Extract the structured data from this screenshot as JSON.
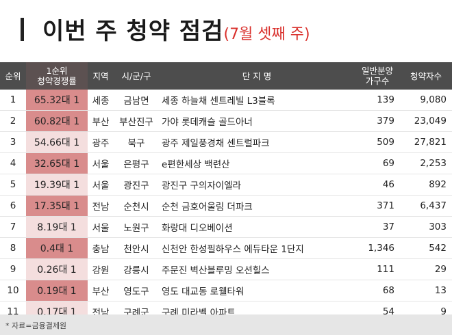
{
  "header": {
    "title": "이번 주 청약 점검",
    "subtitle": "(7월 셋째 주)"
  },
  "table": {
    "columns": {
      "rank": "순위",
      "rate_line1": "1순위",
      "rate_line2": "청약경쟁률",
      "region": "지역",
      "city": "시/군/구",
      "complex": "단 지 명",
      "units_line1": "일반분양",
      "units_line2": "가구수",
      "applicants": "청약자수"
    },
    "rows": [
      {
        "rank": "1",
        "rate": "65.32대 1",
        "region": "세종",
        "city": "금남면",
        "complex": "세종 하늘채 센트레빌 L3블록",
        "units": "139",
        "applicants": "9,080"
      },
      {
        "rank": "2",
        "rate": "60.82대 1",
        "region": "부산",
        "city": "부산진구",
        "complex": "가야 롯데캐슬 골드아너",
        "units": "379",
        "applicants": "23,049"
      },
      {
        "rank": "3",
        "rate": "54.66대 1",
        "region": "광주",
        "city": "북구",
        "complex": "광주 제일풍경채 센트럴파크",
        "units": "509",
        "applicants": "27,821"
      },
      {
        "rank": "4",
        "rate": "32.65대 1",
        "region": "서울",
        "city": "은평구",
        "complex": "e편한세상 백련산",
        "units": "69",
        "applicants": "2,253"
      },
      {
        "rank": "5",
        "rate": "19.39대 1",
        "region": "서울",
        "city": "광진구",
        "complex": "광진구 구의자이엘라",
        "units": "46",
        "applicants": "892"
      },
      {
        "rank": "6",
        "rate": "17.35대 1",
        "region": "전남",
        "city": "순천시",
        "complex": "순천 금호어울림 더파크",
        "units": "371",
        "applicants": "6,437"
      },
      {
        "rank": "7",
        "rate": "8.19대 1",
        "region": "서울",
        "city": "노원구",
        "complex": "화랑대 디오베이션",
        "units": "37",
        "applicants": "303"
      },
      {
        "rank": "8",
        "rate": "0.4대 1",
        "region": "충남",
        "city": "천안시",
        "complex": "신천안 한성필하우스 에듀타운 1단지",
        "units": "1,346",
        "applicants": "542"
      },
      {
        "rank": "9",
        "rate": "0.26대 1",
        "region": "강원",
        "city": "강릉시",
        "complex": "주문진 벽산블루밍 오션힐스",
        "units": "111",
        "applicants": "29"
      },
      {
        "rank": "10",
        "rate": "0.19대 1",
        "region": "부산",
        "city": "영도구",
        "complex": "영도 대교동 로웰타워",
        "units": "68",
        "applicants": "13"
      },
      {
        "rank": "11",
        "rate": "0.17대 1",
        "region": "전남",
        "city": "구례군",
        "complex": "구례 미라벨 아파트",
        "units": "54",
        "applicants": "9"
      }
    ]
  },
  "footer": {
    "source": "* 자료=금융결제원"
  },
  "colors": {
    "highlight_rate": "#d98c8c",
    "light_rate": "#f4dede",
    "header_bg": "#4d4d4d",
    "subtitle_red": "#d9302c"
  }
}
